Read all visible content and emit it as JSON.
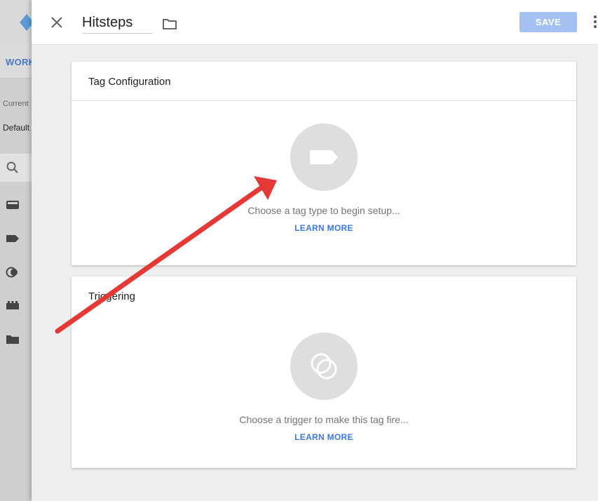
{
  "background_app": {
    "tab_label": "WORK",
    "current_label": "Current",
    "default_label": "Default",
    "accent_color": "#4a78c8"
  },
  "header": {
    "tag_name": "Hitsteps",
    "save_label": "SAVE",
    "save_color": "#a3c1f3"
  },
  "tag_configuration": {
    "title": "Tag Configuration",
    "hint": "Choose a tag type to begin setup...",
    "learn_more": "LEARN MORE",
    "icon": "tag-icon"
  },
  "triggering": {
    "title": "Triggering",
    "hint": "Choose a trigger to make this tag fire...",
    "learn_more": "LEARN MORE",
    "icon": "trigger-icon"
  },
  "annotation": {
    "color": "#e53935",
    "icon": "arrow-annotation"
  }
}
